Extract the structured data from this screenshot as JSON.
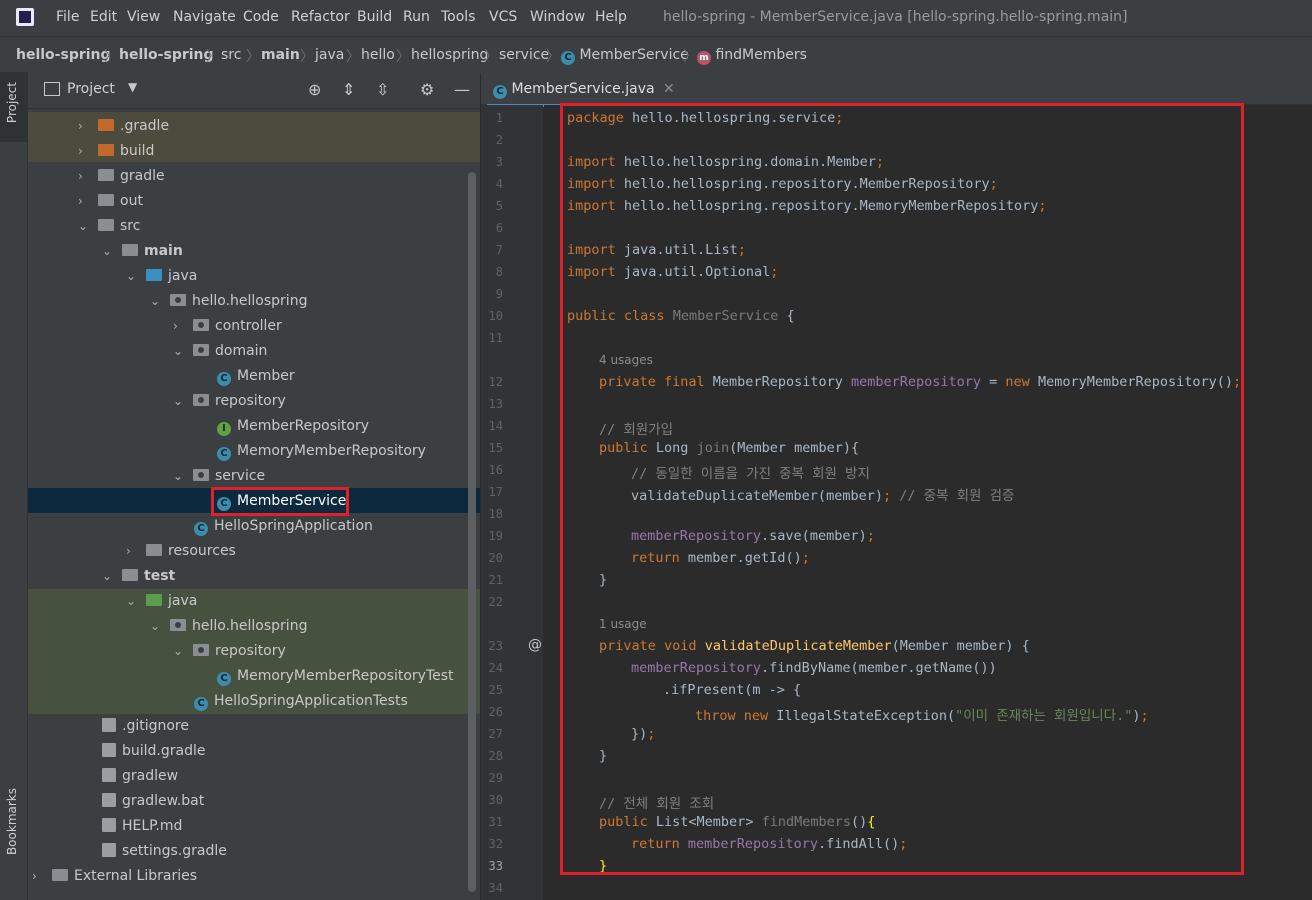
{
  "menubar": {
    "items": [
      "File",
      "Edit",
      "View",
      "Navigate",
      "Code",
      "Refactor",
      "Build",
      "Run",
      "Tools",
      "VCS",
      "Window",
      "Help"
    ],
    "window_title": "hello-spring - MemberService.java [hello-spring.hello-spring.main]"
  },
  "breadcrumb": [
    "hello-spring",
    "hello-spring",
    "src",
    "main",
    "java",
    "hello",
    "hellospring",
    "service",
    "MemberService",
    "findMembers"
  ],
  "left_stripe": {
    "project_tab": "Project",
    "bookmarks_tab": "Bookmarks"
  },
  "project_panel": {
    "title": "Project",
    "tree": [
      {
        "label": ".gradle"
      },
      {
        "label": "build"
      },
      {
        "label": "gradle"
      },
      {
        "label": "out"
      },
      {
        "label": "src"
      },
      {
        "label": "main"
      },
      {
        "label": "java"
      },
      {
        "label": "hello.hellospring"
      },
      {
        "label": "controller"
      },
      {
        "label": "domain"
      },
      {
        "label": "Member"
      },
      {
        "label": "repository"
      },
      {
        "label": "MemberRepository"
      },
      {
        "label": "MemoryMemberRepository"
      },
      {
        "label": "service"
      },
      {
        "label": "MemberService"
      },
      {
        "label": "HelloSpringApplication"
      },
      {
        "label": "resources"
      },
      {
        "label": "test"
      },
      {
        "label": "java"
      },
      {
        "label": "hello.hellospring"
      },
      {
        "label": "repository"
      },
      {
        "label": "MemoryMemberRepositoryTest"
      },
      {
        "label": "HelloSpringApplicationTests"
      },
      {
        "label": ".gitignore"
      },
      {
        "label": "build.gradle"
      },
      {
        "label": "gradlew"
      },
      {
        "label": "gradlew.bat"
      },
      {
        "label": "HELP.md"
      },
      {
        "label": "settings.gradle"
      },
      {
        "label": "External Libraries"
      }
    ]
  },
  "editor": {
    "tab_label": "MemberService.java",
    "line_numbers": [
      "1",
      "2",
      "3",
      "4",
      "5",
      "6",
      "7",
      "8",
      "9",
      "10",
      "11",
      "12",
      "13",
      "14",
      "15",
      "16",
      "17",
      "18",
      "19",
      "20",
      "21",
      "22",
      "23",
      "24",
      "25",
      "26",
      "27",
      "28",
      "29",
      "30",
      "31",
      "32",
      "33",
      "34"
    ],
    "hints": {
      "usages_4": "4 usages",
      "usages_1": "1 usage"
    },
    "code": {
      "l1": "package hello.hellospring.service;",
      "l3": "import hello.hellospring.domain.Member;",
      "l4": "import hello.hellospring.repository.MemberRepository;",
      "l5": "import hello.hellospring.repository.MemoryMemberRepository;",
      "l7": "import java.util.List;",
      "l8": "import java.util.Optional;",
      "l10": "public class MemberService {",
      "l12": "private final MemberRepository memberRepository = new MemoryMemberRepository();",
      "l14": "// 회원가입",
      "l15": "public Long join(Member member){",
      "l16": "// 동일한 이름을 가진 중복 회원 방지",
      "l17": "validateDuplicateMember(member); // 중복 회원 검증",
      "l19": "memberRepository.save(member);",
      "l20": "return member.getId();",
      "l21": "}",
      "l23": "private void validateDuplicateMember(Member member) {",
      "l24": "memberRepository.findByName(member.getName())",
      "l25": ".ifPresent(m -> {",
      "l26": "throw new IllegalStateException(\"이미 존재하는 회원입니다.\");",
      "l27": "});",
      "l28": "}",
      "l30": "// 전체 회원 조회",
      "l31": "public List<Member> findMembers(){",
      "l32": "return memberRepository.findAll();",
      "l33": "}"
    }
  },
  "colors": {
    "highlight_box": "#e0202a",
    "selected_row": "#0d293e",
    "keyword": "#cc7832",
    "field": "#9876aa",
    "comment": "#808080",
    "string": "#6a8759"
  }
}
